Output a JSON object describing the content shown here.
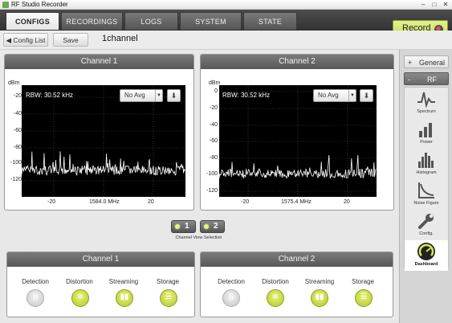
{
  "app_title": "RF Studio Recorder",
  "window_controls": {
    "minimize": "–",
    "maximize": "□",
    "close": "✕"
  },
  "tabs": [
    {
      "label": "CONFIGS",
      "active": true
    },
    {
      "label": "RECORDINGS",
      "active": false
    },
    {
      "label": "LOGS",
      "active": false
    },
    {
      "label": "SYSTEM",
      "active": false
    },
    {
      "label": "STATE",
      "active": false
    }
  ],
  "record": {
    "label": "Record"
  },
  "toolbar": {
    "back_label": "Config List",
    "save_label": "Save",
    "config_name": "1channel"
  },
  "channels": [
    {
      "title": "Channel 1",
      "unit": "dBm",
      "rbw": "RBW: 30.52 kHz",
      "avg": "No Avg",
      "y_ticks": [
        "-20",
        "-40",
        "-60",
        "-80",
        "-100",
        "-120"
      ],
      "x_ticks": [
        "-20",
        "1584.0 MHz",
        "20"
      ]
    },
    {
      "title": "Channel 2",
      "unit": "dBm",
      "rbw": "RBW: 30.52 kHz",
      "avg": "No Avg",
      "y_ticks": [
        "0",
        "-20",
        "-40",
        "-60",
        "-80",
        "-100",
        "-120"
      ],
      "x_ticks": [
        "-20",
        "1575.4 MHz",
        "20"
      ]
    }
  ],
  "channel_selection": {
    "buttons": [
      "1",
      "2"
    ],
    "caption": "Channel View Selection"
  },
  "status_panels": [
    {
      "title": "Channel 1",
      "items": [
        {
          "label": "Detection",
          "state": "off"
        },
        {
          "label": "Distortion",
          "state": "on"
        },
        {
          "label": "Streaming",
          "state": "on"
        },
        {
          "label": "Storage",
          "state": "on"
        }
      ]
    },
    {
      "title": "Channel 2",
      "items": [
        {
          "label": "Detection",
          "state": "off"
        },
        {
          "label": "Distortion",
          "state": "on"
        },
        {
          "label": "Streaming",
          "state": "on"
        },
        {
          "label": "Storage",
          "state": "on"
        }
      ]
    }
  ],
  "sidebar": {
    "general": {
      "sign": "+",
      "label": "General"
    },
    "rf": {
      "sign": "-",
      "label": "RF"
    },
    "rf_items": [
      {
        "label": "Spectrum",
        "icon": "spectrum-icon"
      },
      {
        "label": "Power",
        "icon": "power-bars-icon"
      },
      {
        "label": "Histogram",
        "icon": "histogram-icon"
      },
      {
        "label": "Noise Figure",
        "icon": "noise-figure-icon"
      },
      {
        "label": "Config.",
        "icon": "wrench-icon"
      },
      {
        "label": "Dashboard",
        "icon": "dashboard-gauge-icon",
        "active": true
      }
    ]
  },
  "colors": {
    "accent_green": "#c6dc52",
    "plot_bg": "#000000",
    "trace": "#ffffff",
    "header_gray": "#666666"
  }
}
